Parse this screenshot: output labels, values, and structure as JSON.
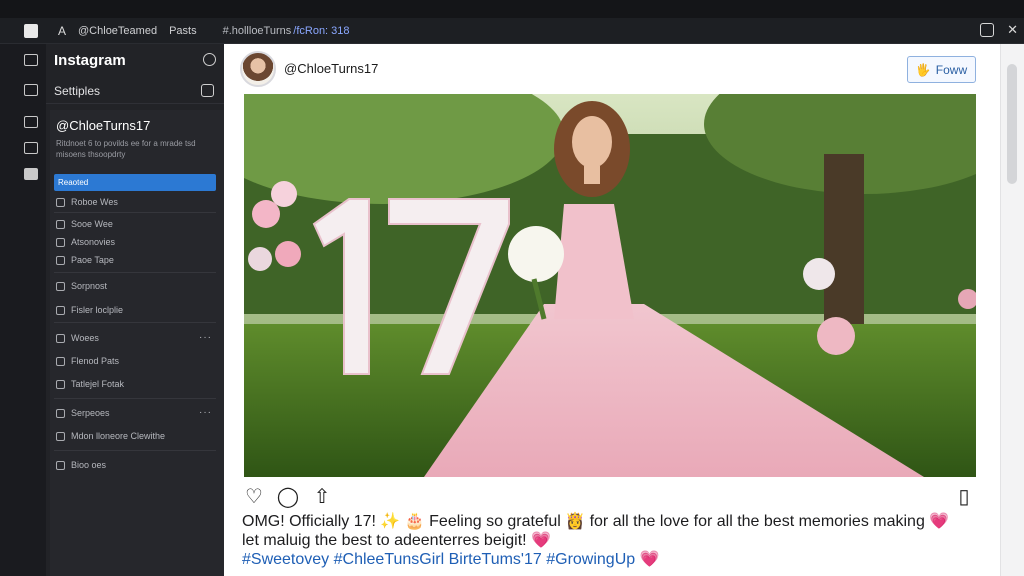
{
  "topbar": {
    "glyph": "A",
    "account": "@ChloeTeamed",
    "posts": "Pasts",
    "breadcrumb": "#.hollloeTurns",
    "path": "/fcRon: 318"
  },
  "sidebar": {
    "title": "Instagram",
    "settings_label": "Settiples",
    "profile_name": "@ChloeTurns17",
    "profile_desc": "Ritdnoet 6 to povilds ee for a mrade tsd misoens thsoopdrty",
    "selected_item": "Reaoted",
    "items": [
      {
        "label": "Roboe Wes"
      },
      {
        "label": "Sooe Wee"
      },
      {
        "label": "Atsonovies"
      },
      {
        "label": "Paoe Tape"
      },
      {
        "label": "Sorpnost"
      },
      {
        "label": "Fisler loclplie"
      },
      {
        "label": "Woees"
      },
      {
        "label": "Flenod Pats"
      },
      {
        "label": "Tatlejel Fotak"
      },
      {
        "label": "Serpeoes"
      },
      {
        "label": "Mdon lloneore Clewithe"
      },
      {
        "label": "Bioo oes"
      }
    ]
  },
  "post": {
    "handle": "@ChloeTurns17",
    "follow_label": "Foww",
    "caption_line1": "OMG! Officially 17! ✨ 🎂 Feeling so grateful 👸 for all the love for all the best memories making 💗",
    "caption_line2": "let maluig the best to adeenterres beigit! 💗",
    "hashtags": "#Sweetovey #ChleeTunsGirl BirteTums'17 #GrowingUp 💗"
  },
  "colors": {
    "accent": "#2c79d3",
    "sidebar_bg": "#222327",
    "follow_border": "#8fb1df"
  }
}
